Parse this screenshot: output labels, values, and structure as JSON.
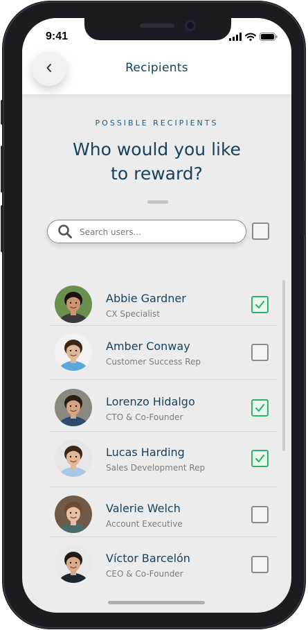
{
  "status_bar": {
    "time": "9:41"
  },
  "header": {
    "title": "Recipients",
    "back_label": "‹"
  },
  "intro": {
    "overline": "POSSIBLE RECIPIENTS",
    "headline_line1": "Who would you like",
    "headline_line2": "to reward?"
  },
  "search": {
    "placeholder": "Search users...",
    "value": ""
  },
  "select_all": {
    "checked": false
  },
  "recipients": [
    {
      "name": "Abbie Gardner",
      "role": "CX Specialist",
      "selected": true,
      "skin": "#c99572",
      "hair": "#1c1310",
      "shirt": "#3a3a3a",
      "bg": "#6b8f4e"
    },
    {
      "name": "Amber Conway",
      "role": "Customer Success Rep",
      "selected": false,
      "skin": "#e1b79a",
      "hair": "#3a2414",
      "shirt": "#5aa8d6",
      "bg": "#f2f2f2"
    },
    {
      "name": "Lorenzo Hidalgo",
      "role": "CTO & Co-Founder",
      "selected": true,
      "skin": "#d6a586",
      "hair": "#2a1d16",
      "shirt": "#2e4a6e",
      "bg": "#8a8680"
    },
    {
      "name": "Lucas Harding",
      "role": "Sales Development Rep",
      "selected": true,
      "skin": "#e2b897",
      "hair": "#3b271a",
      "shirt": "#a8c8e6",
      "bg": "#e6e6e6"
    },
    {
      "name": "Valerie Welch",
      "role": "Account Executive",
      "selected": false,
      "skin": "#e7c0a3",
      "hair": "#6e4a2e",
      "shirt": "#4b6b6b",
      "bg": "#6f5a47"
    },
    {
      "name": "Víctor Barcelón",
      "role": "CEO & Co-Founder",
      "selected": false,
      "skin": "#d9ab8a",
      "hair": "#241a14",
      "shirt": "#1f2630",
      "bg": "#e9e9e9"
    }
  ],
  "colors": {
    "accent": "#17415f",
    "check_green": "#2fb36a"
  }
}
